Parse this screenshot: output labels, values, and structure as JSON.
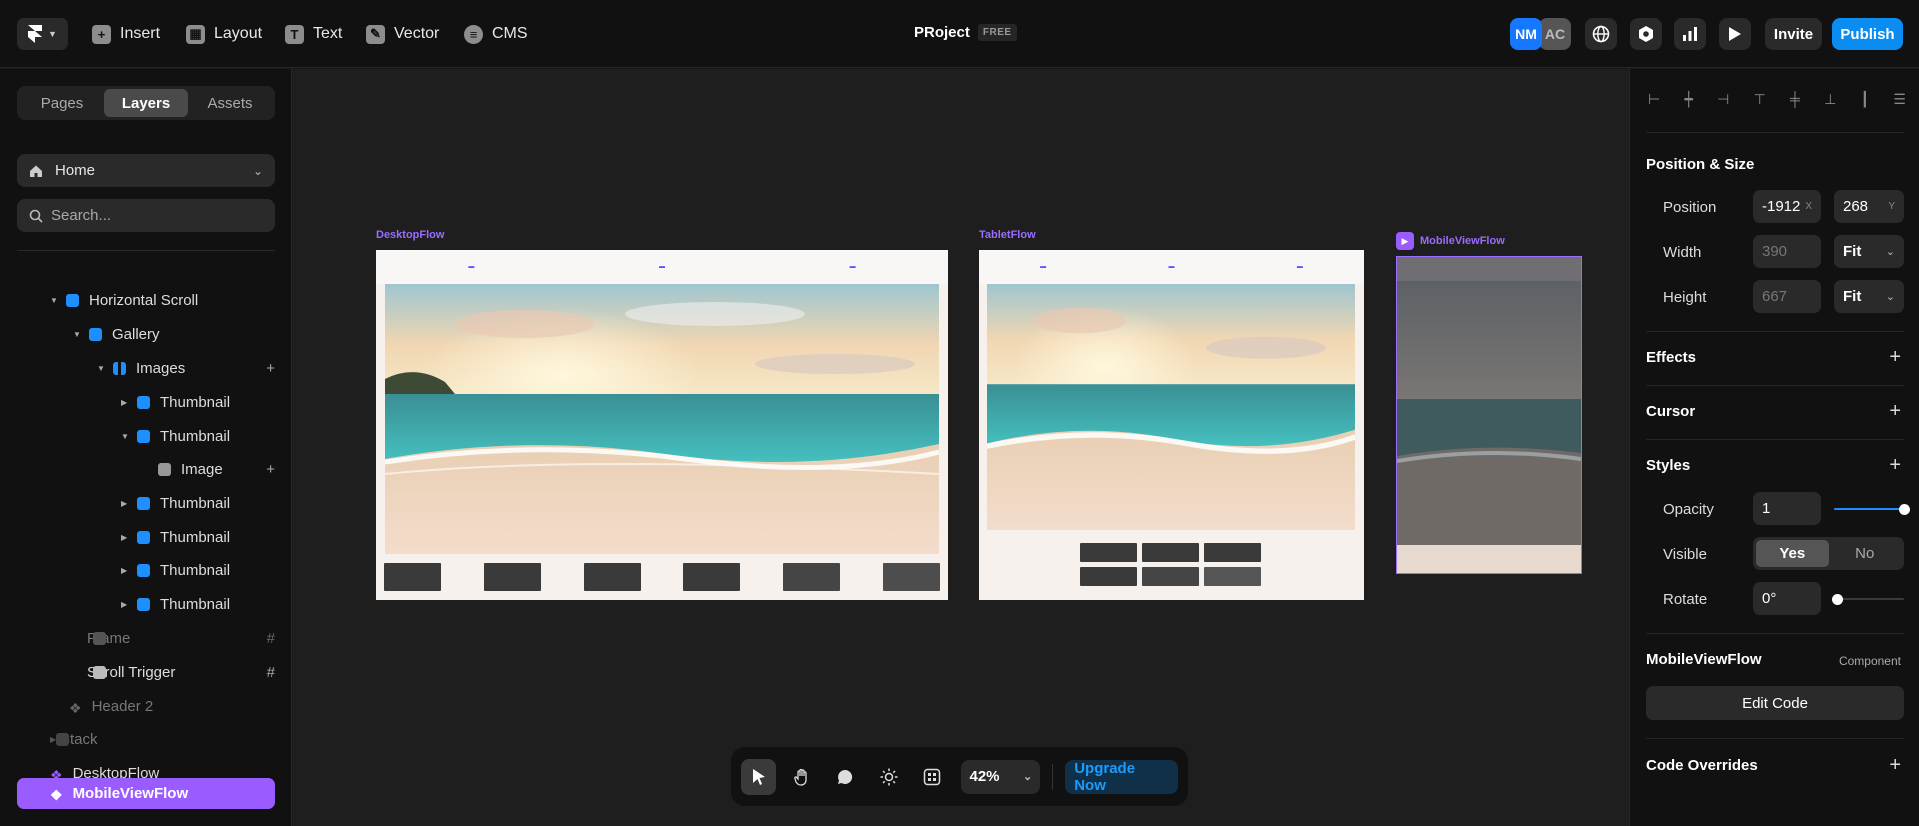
{
  "topbar": {
    "tools": [
      {
        "label": "Insert",
        "icon": "plus-icon"
      },
      {
        "label": "Layout",
        "icon": "layout-icon"
      },
      {
        "label": "Text",
        "icon": "text-icon"
      },
      {
        "label": "Vector",
        "icon": "pen-icon"
      },
      {
        "label": "CMS",
        "icon": "database-icon"
      }
    ],
    "project_title": "PRoject",
    "plan_badge": "FREE",
    "avatars": [
      "NM",
      "AC"
    ],
    "invite_label": "Invite",
    "publish_label": "Publish",
    "publish_color": "#0a8cf0"
  },
  "left": {
    "tabs": [
      "Pages",
      "Layers",
      "Assets"
    ],
    "active_tab": "Layers",
    "page": "Home",
    "search_placeholder": "Search...",
    "layers": [
      {
        "label": "Horizontal Scroll",
        "icon": "stack-icon"
      },
      {
        "label": "Gallery",
        "icon": "stack-icon"
      },
      {
        "label": "Images",
        "icon": "horizontal-stack-icon"
      },
      {
        "label": "Thumbnail",
        "icon": "stack-icon"
      },
      {
        "label": "Thumbnail",
        "icon": "stack-icon"
      },
      {
        "label": "Image",
        "icon": "image-icon"
      },
      {
        "label": "Thumbnail",
        "icon": "stack-icon"
      },
      {
        "label": "Thumbnail",
        "icon": "stack-icon"
      },
      {
        "label": "Thumbnail",
        "icon": "stack-icon"
      },
      {
        "label": "Thumbnail",
        "icon": "stack-icon"
      },
      {
        "label": "Frame",
        "icon": "frame-icon"
      },
      {
        "label": "Scroll Trigger",
        "icon": "frame-icon"
      },
      {
        "label": "Header 2",
        "icon": "component-icon"
      },
      {
        "label": "Stack",
        "icon": "stack-icon"
      },
      {
        "label": "DesktopFlow",
        "icon": "component-icon"
      },
      {
        "label": "MobileViewFlow",
        "icon": "component-icon"
      }
    ],
    "selected_color": "#9a5cff"
  },
  "canvas": {
    "frames": [
      {
        "label": "DesktopFlow"
      },
      {
        "label": "TabletFlow"
      },
      {
        "label": "MobileViewFlow"
      }
    ]
  },
  "bottombar": {
    "tools": [
      "cursor-icon",
      "hand-icon",
      "comment-icon",
      "theme-icon",
      "component-icon"
    ],
    "zoom": "42%",
    "upgrade_label": "Upgrade Now"
  },
  "right": {
    "position_size_title": "Position & Size",
    "position_label": "Position",
    "pos_x": "-1912",
    "pos_x_suffix": "X",
    "pos_y": "268",
    "pos_y_suffix": "Y",
    "width_label": "Width",
    "width_value": "390",
    "width_mode": "Fit",
    "height_label": "Height",
    "height_value": "667",
    "height_mode": "Fit",
    "effects_title": "Effects",
    "cursor_title": "Cursor",
    "styles_title": "Styles",
    "opacity_label": "Opacity",
    "opacity_value": "1",
    "opacity_level": 1,
    "visible_label": "Visible",
    "visible_yes": "Yes",
    "visible_no": "No",
    "rotate_label": "Rotate",
    "rotate_value": "0°",
    "component_name": "MobileViewFlow",
    "component_tag": "Component",
    "edit_code_label": "Edit Code",
    "code_overrides_title": "Code Overrides"
  }
}
